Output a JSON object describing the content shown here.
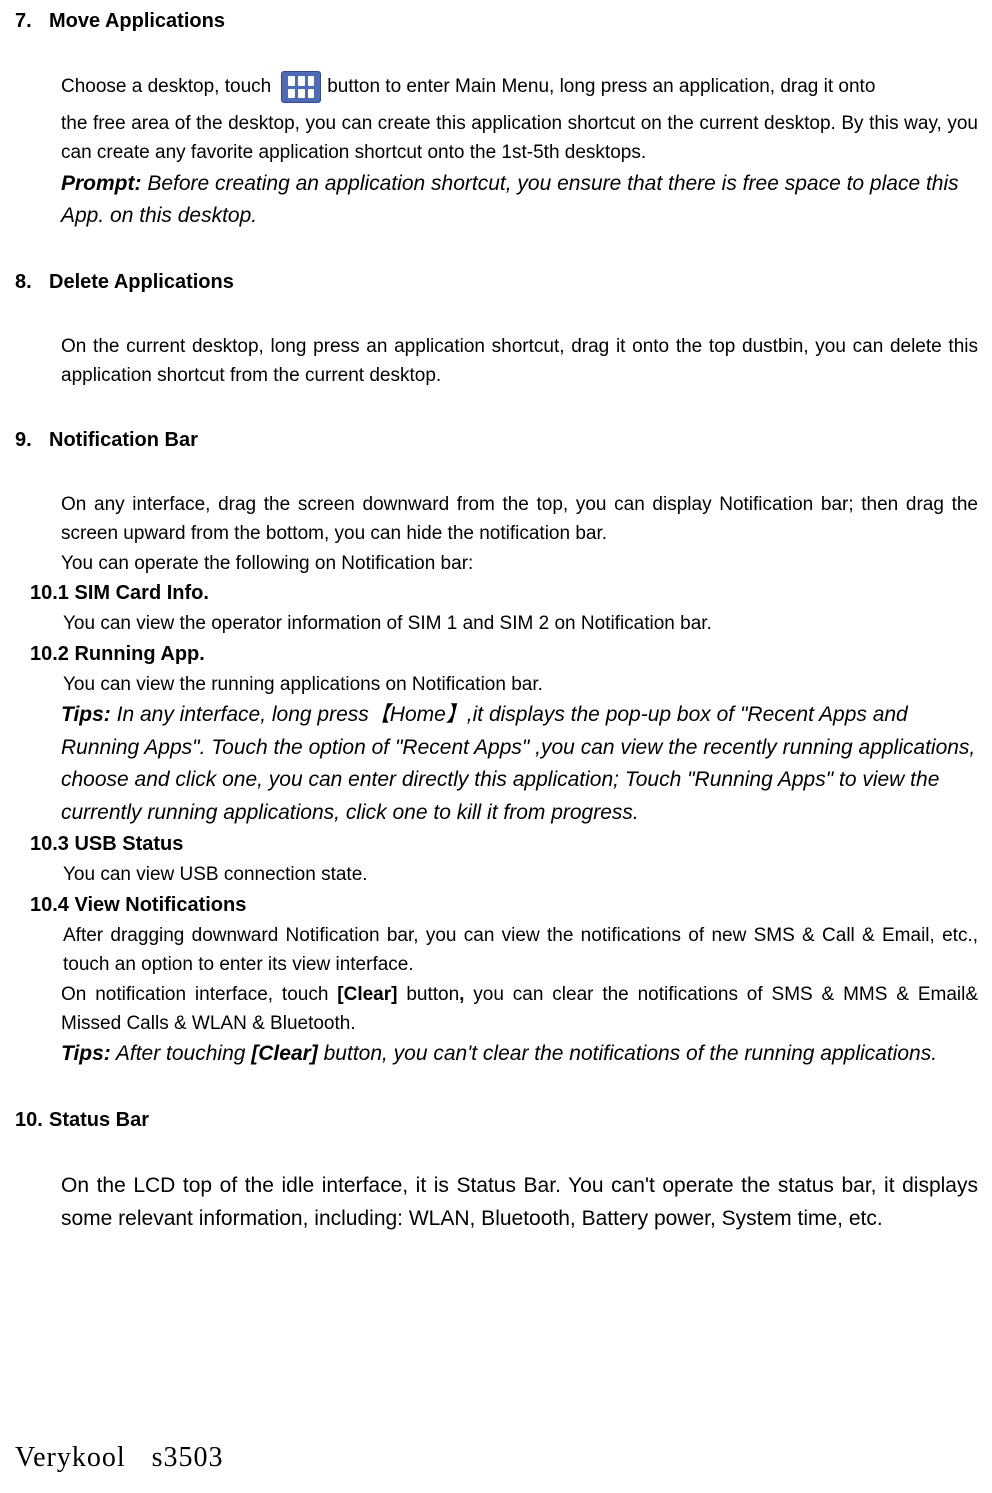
{
  "s7": {
    "num": "7.",
    "title": "Move Applications",
    "p1a": "Choose a desktop, touch",
    "p1b": "button to enter Main Menu, long press an application, drag it onto",
    "p2": "the free area of the desktop, you can create this application shortcut on the current desktop. By this way, you can create any favorite application shortcut onto the 1st-5th desktops.",
    "prompt_lead": "Prompt:",
    "prompt": " Before creating an application shortcut, you ensure that there is free space to place this App. on this desktop."
  },
  "s8": {
    "num": "8.",
    "title": "Delete Applications",
    "p1": "On the current desktop, long press an application shortcut, drag it onto the top dustbin, you can delete this application shortcut from the current desktop."
  },
  "s9": {
    "num": "9.",
    "title": "Notification Bar",
    "p1": "On any interface, drag the screen downward from the top, you can display Notification bar; then drag the screen upward from the bottom, you can hide the notification bar.",
    "p2": "You can operate the following on Notification bar:"
  },
  "s10_1": {
    "title": "10.1 SIM Card Info.",
    "p1": "You can view the operator information of SIM 1 and SIM 2 on Notification bar."
  },
  "s10_2": {
    "title": "10.2 Running App.",
    "p1": "You can view the running applications on Notification bar.",
    "tips_lead": "Tips:",
    "tips": " In any interface, long press【Home】,it displays the pop-up box of \"Recent Apps and Running Apps\". Touch the option of \"Recent Apps\" ,you can view the recently running applications, choose and click one, you can enter directly this application; Touch \"Running Apps\" to view the currently running applications, click one to kill it from progress."
  },
  "s10_3": {
    "title": "10.3 USB Status",
    "p1": "You can view USB connection state."
  },
  "s10_4": {
    "title": "10.4 View Notifications",
    "p1": "After dragging downward Notification bar, you can view the notifications of new SMS & Call & Email, etc., touch an option to enter its view interface.",
    "p2a": "On notification interface, touch ",
    "p2_clear": "[Clear]",
    "p2b": " button",
    "p2_comma": ",",
    "p2c": " you can clear the notifications of SMS & MMS & Email& Missed Calls & WLAN & Bluetooth.",
    "tips_lead": "Tips:",
    "tips_a": " After touching ",
    "tips_clear": "[Clear]",
    "tips_b": " button, you can't clear the notifications of the running applications."
  },
  "s10": {
    "num": "10.",
    "title": "Status Bar",
    "p1": "On the LCD top of the idle interface, it is Status Bar. You can't operate the status bar, it displays some relevant information, including: WLAN, Bluetooth, Battery power, System time, etc."
  },
  "footer": "Verykool s3503"
}
